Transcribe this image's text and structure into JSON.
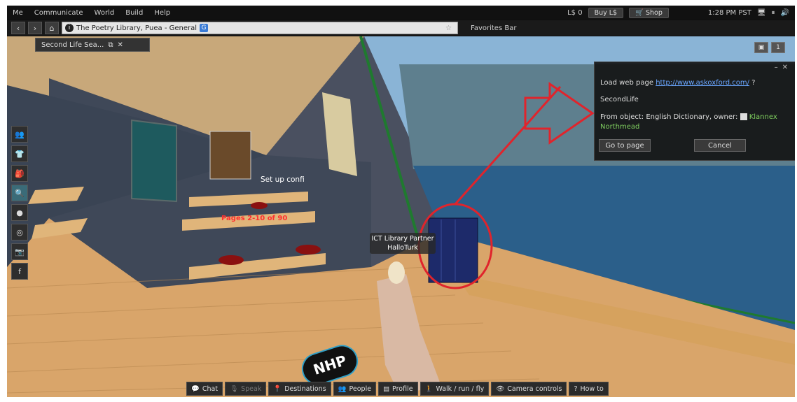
{
  "menubar": {
    "items": [
      "Me",
      "Communicate",
      "World",
      "Build",
      "Help"
    ],
    "balance": "L$ 0",
    "buy_label": "Buy L$",
    "shop_label": "Shop",
    "clock": "1:28 PM PST"
  },
  "navbar": {
    "location": "The Poetry Library, Puea - General",
    "rating_badge": "G",
    "favorites_label": "Favorites Bar"
  },
  "floater_tab": {
    "title": "Second Life Sea..."
  },
  "scene": {
    "nametag_line1": "ICT Library Partner",
    "nametag_line2": "HalloTurk",
    "setup_text": "Set up confi",
    "pages_text": "Pages 2-10 of 90",
    "nhp_logo": "NHP"
  },
  "dialog": {
    "prompt_prefix": "Load web page",
    "url": "http://www.askoxford.com/",
    "prompt_suffix": "?",
    "app_name": "SecondLife",
    "from_prefix": "From object: English Dictionary, owner:",
    "owner_first": "Klannex",
    "owner_last": "Northmead",
    "go_label": "Go to page",
    "cancel_label": "Cancel"
  },
  "bottombar": {
    "chat": "Chat",
    "speak": "Speak",
    "destinations": "Destinations",
    "people": "People",
    "profile": "Profile",
    "walk": "Walk / run / fly",
    "camera": "Camera controls",
    "howto": "How to"
  },
  "colors": {
    "highlight_red": "#e0242c",
    "link_blue": "#6aa6ff",
    "owner_green": "#7fcf5f"
  }
}
